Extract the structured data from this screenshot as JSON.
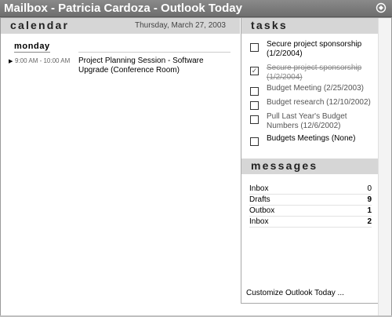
{
  "window": {
    "title": "Mailbox - Patricia Cardoza - Outlook Today",
    "icon": "outlook-today-icon"
  },
  "calendar": {
    "header": "calendar",
    "date": "Thursday, March 27, 2003",
    "day": "monday",
    "appointments": [
      {
        "time": "9:00 AM - 10:00 AM",
        "subject": "Project Planning Session - Software Upgrade (Conference Room)"
      }
    ]
  },
  "tasks": {
    "header": "tasks",
    "items": [
      {
        "label": "Secure project sponsorship (1/2/2004)",
        "checked": false,
        "style": "normal"
      },
      {
        "label": "Secure project sponsorship (1/2/2004)",
        "checked": true,
        "style": "done"
      },
      {
        "label": "Budget Meeting (2/25/2003)",
        "checked": false,
        "style": "overdue"
      },
      {
        "label": "Budget research (12/10/2002)",
        "checked": false,
        "style": "overdue"
      },
      {
        "label": "Pull Last Year's Budget Numbers (12/6/2002)",
        "checked": false,
        "style": "overdue"
      },
      {
        "label": "Budgets Meetings (None)",
        "checked": false,
        "style": "normal"
      }
    ]
  },
  "messages": {
    "header": "messages",
    "rows": [
      {
        "folder": "Inbox",
        "count": "0",
        "bold": false
      },
      {
        "folder": "Drafts",
        "count": "9",
        "bold": true
      },
      {
        "folder": "Outbox",
        "count": "1",
        "bold": true
      },
      {
        "folder": "Inbox",
        "count": "2",
        "bold": true
      }
    ]
  },
  "customize_link": "Customize Outlook Today ..."
}
